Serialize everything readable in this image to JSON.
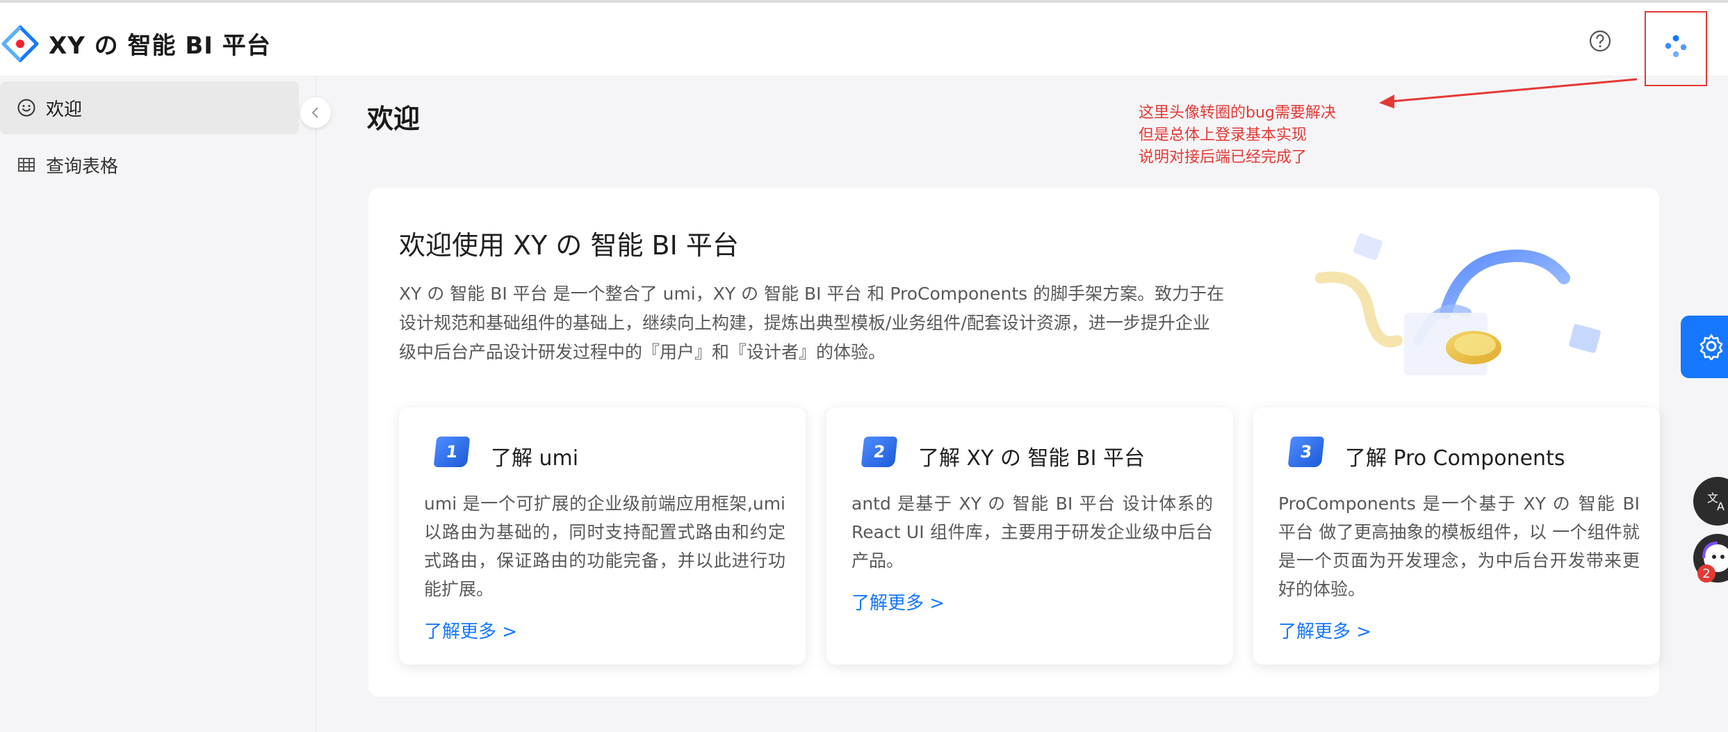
{
  "header": {
    "title": "XY の 智能 BI 平台",
    "help_icon": "question-circle-icon",
    "avatar_state": "loading-spinner"
  },
  "sidebar": {
    "items": [
      {
        "label": "欢迎",
        "icon": "smile-icon",
        "active": true
      },
      {
        "label": "查询表格",
        "icon": "table-icon",
        "active": false
      }
    ],
    "collapse_icon": "chevron-left-icon"
  },
  "main": {
    "page_title": "欢迎",
    "annotation": [
      "这里头像转圈的bug需要解决",
      "但是总体上登录基本实现",
      "说明对接后端已经完成了"
    ],
    "welcome": {
      "title": "欢迎使用 XY の 智能 BI 平台",
      "description": "XY の 智能 BI 平台 是一个整合了 umi，XY の 智能 BI 平台 和 ProComponents 的脚手架方案。致力于在设计规范和基础组件的基础上，继续向上构建，提炼出典型模板/业务组件/配套设计资源，进一步提升企业级中后台产品设计研发过程中的『用户』和『设计者』的体验。"
    },
    "cards": [
      {
        "index": "1",
        "title": "了解 umi",
        "description": "umi 是一个可扩展的企业级前端应用框架,umi 以路由为基础的，同时支持配置式路由和约定式路由，保证路由的功能完备，并以此进行功能扩展。",
        "link": "了解更多 >"
      },
      {
        "index": "2",
        "title": "了解 XY の 智能 BI 平台",
        "description": "antd 是基于 XY の 智能 BI 平台 设计体系的 React UI 组件库，主要用于研发企业级中后台产品。",
        "link": "了解更多 >"
      },
      {
        "index": "3",
        "title": "了解 Pro Components",
        "description": "ProComponents 是一个基于 XY の 智能 BI 平台 做了更高抽象的模板组件，以 一个组件就是一个页面为开发理念，为中后台开发带来更好的体验。",
        "link": "了解更多 >"
      }
    ]
  },
  "floating": {
    "settings_icon": "gear-icon",
    "translate_icon": "translate-icon",
    "chat_count": "2"
  },
  "colors": {
    "primary": "#1677ff",
    "annotation": "#e53935"
  }
}
